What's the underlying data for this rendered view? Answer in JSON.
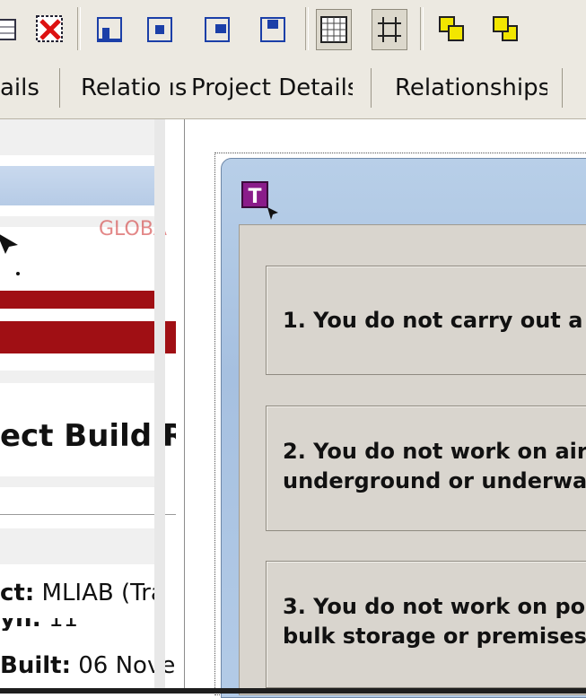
{
  "toolbar": {
    "icons": [
      "sheet-icon",
      "delete-table-icon",
      "align-bottom-icon",
      "align-center-icon",
      "align-right-icon",
      "align-top-icon",
      "grid-icon",
      "snap-grid-icon",
      "bring-front-icon",
      "send-back-icon"
    ]
  },
  "tabs": {
    "items": [
      "ails",
      "Relatio ıѕ",
      "Project Details",
      "Relationships"
    ]
  },
  "left_panel": {
    "logo_fragment": "GLOBA",
    "heading": "ect Build Re",
    "lines": [
      {
        "label": "ct:",
        "value": " MLIAB (Tra"
      },
      {
        "label": "yn:",
        "value": " 11"
      },
      {
        "label": "Built:",
        "value": " 06 Nove"
      }
    ]
  },
  "canvas": {
    "cards": [
      {
        "lines": [
          "1. You do not carry out a"
        ]
      },
      {
        "lines": [
          "2. You do not work on air",
          "underground or underwa"
        ]
      },
      {
        "lines": [
          "3. You do not work on po",
          "bulk storage or premises"
        ]
      }
    ]
  }
}
